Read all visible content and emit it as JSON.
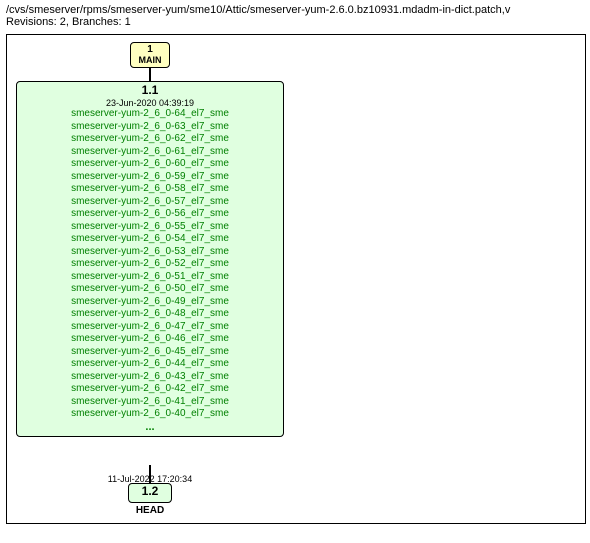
{
  "path": "/cvs/smeserver/rpms/smeserver-yum/sme10/Attic/smeserver-yum-2.6.0.bz10931.mdadm-in-dict.patch,v",
  "meta": "Revisions: 2, Branches: 1",
  "branch": {
    "num": "1",
    "name": "MAIN"
  },
  "rev1": {
    "title": "1.1",
    "date": "23-Jun-2020 04:39:19",
    "tags": [
      "smeserver-yum-2_6_0-64_el7_sme",
      "smeserver-yum-2_6_0-63_el7_sme",
      "smeserver-yum-2_6_0-62_el7_sme",
      "smeserver-yum-2_6_0-61_el7_sme",
      "smeserver-yum-2_6_0-60_el7_sme",
      "smeserver-yum-2_6_0-59_el7_sme",
      "smeserver-yum-2_6_0-58_el7_sme",
      "smeserver-yum-2_6_0-57_el7_sme",
      "smeserver-yum-2_6_0-56_el7_sme",
      "smeserver-yum-2_6_0-55_el7_sme",
      "smeserver-yum-2_6_0-54_el7_sme",
      "smeserver-yum-2_6_0-53_el7_sme",
      "smeserver-yum-2_6_0-52_el7_sme",
      "smeserver-yum-2_6_0-51_el7_sme",
      "smeserver-yum-2_6_0-50_el7_sme",
      "smeserver-yum-2_6_0-49_el7_sme",
      "smeserver-yum-2_6_0-48_el7_sme",
      "smeserver-yum-2_6_0-47_el7_sme",
      "smeserver-yum-2_6_0-46_el7_sme",
      "smeserver-yum-2_6_0-45_el7_sme",
      "smeserver-yum-2_6_0-44_el7_sme",
      "smeserver-yum-2_6_0-43_el7_sme",
      "smeserver-yum-2_6_0-42_el7_sme",
      "smeserver-yum-2_6_0-41_el7_sme",
      "smeserver-yum-2_6_0-40_el7_sme"
    ],
    "dots": "..."
  },
  "rev2": {
    "title": "1.2",
    "date": "11-Jul-2022 17:20:34",
    "name": "HEAD"
  }
}
